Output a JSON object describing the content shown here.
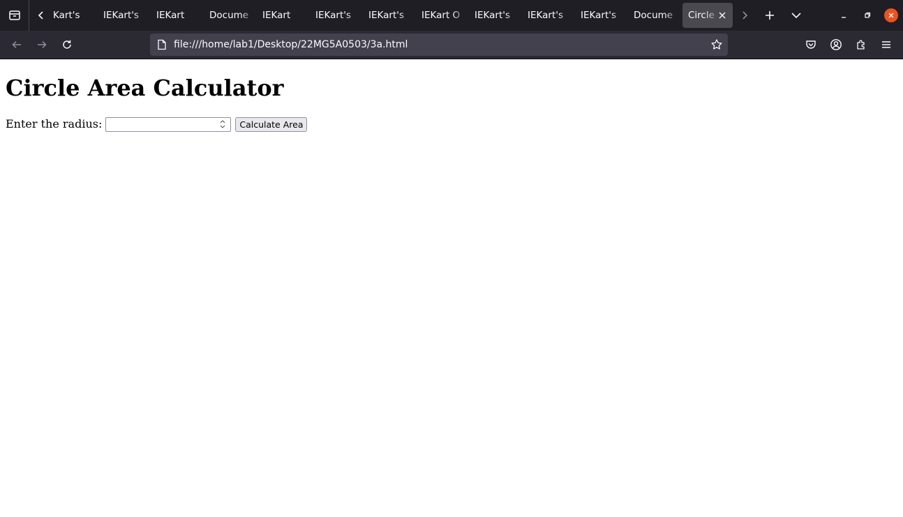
{
  "browser": {
    "tabs": [
      {
        "title": "Kart's"
      },
      {
        "title": "IEKart's"
      },
      {
        "title": "IEKart"
      },
      {
        "title": "Docume"
      },
      {
        "title": "IEKart"
      },
      {
        "title": "IEKart's"
      },
      {
        "title": "IEKart's"
      },
      {
        "title": "IEKart O"
      },
      {
        "title": "IEKart's"
      },
      {
        "title": "IEKart's"
      },
      {
        "title": "IEKart's"
      },
      {
        "title": "Docume"
      }
    ],
    "active_tab": {
      "title": "Circle"
    },
    "url": "file:///home/lab1/Desktop/22MG5A0503/3a.html",
    "colors": {
      "chrome": "#1f1e25",
      "toolbar": "#2b2a33",
      "urlbar": "#42414d",
      "close_button": "#e95420"
    }
  },
  "page": {
    "title": "Circle Area Calculator",
    "radius_label": "Enter the radius:",
    "radius_value": "",
    "button_label": "Calculate Area"
  },
  "icons": {
    "tab_list": "tab-list-icon",
    "scroll_left": "chevron-left-icon",
    "scroll_right": "chevron-right-icon",
    "new_tab": "plus-icon",
    "all_tabs": "chevron-down-icon",
    "back": "arrow-left-icon",
    "forward": "arrow-right-icon",
    "reload": "reload-icon",
    "page": "page-icon",
    "bookmark": "star-icon",
    "pocket": "pocket-icon",
    "account": "account-icon",
    "extensions": "puzzle-icon",
    "menu": "hamburger-icon"
  }
}
